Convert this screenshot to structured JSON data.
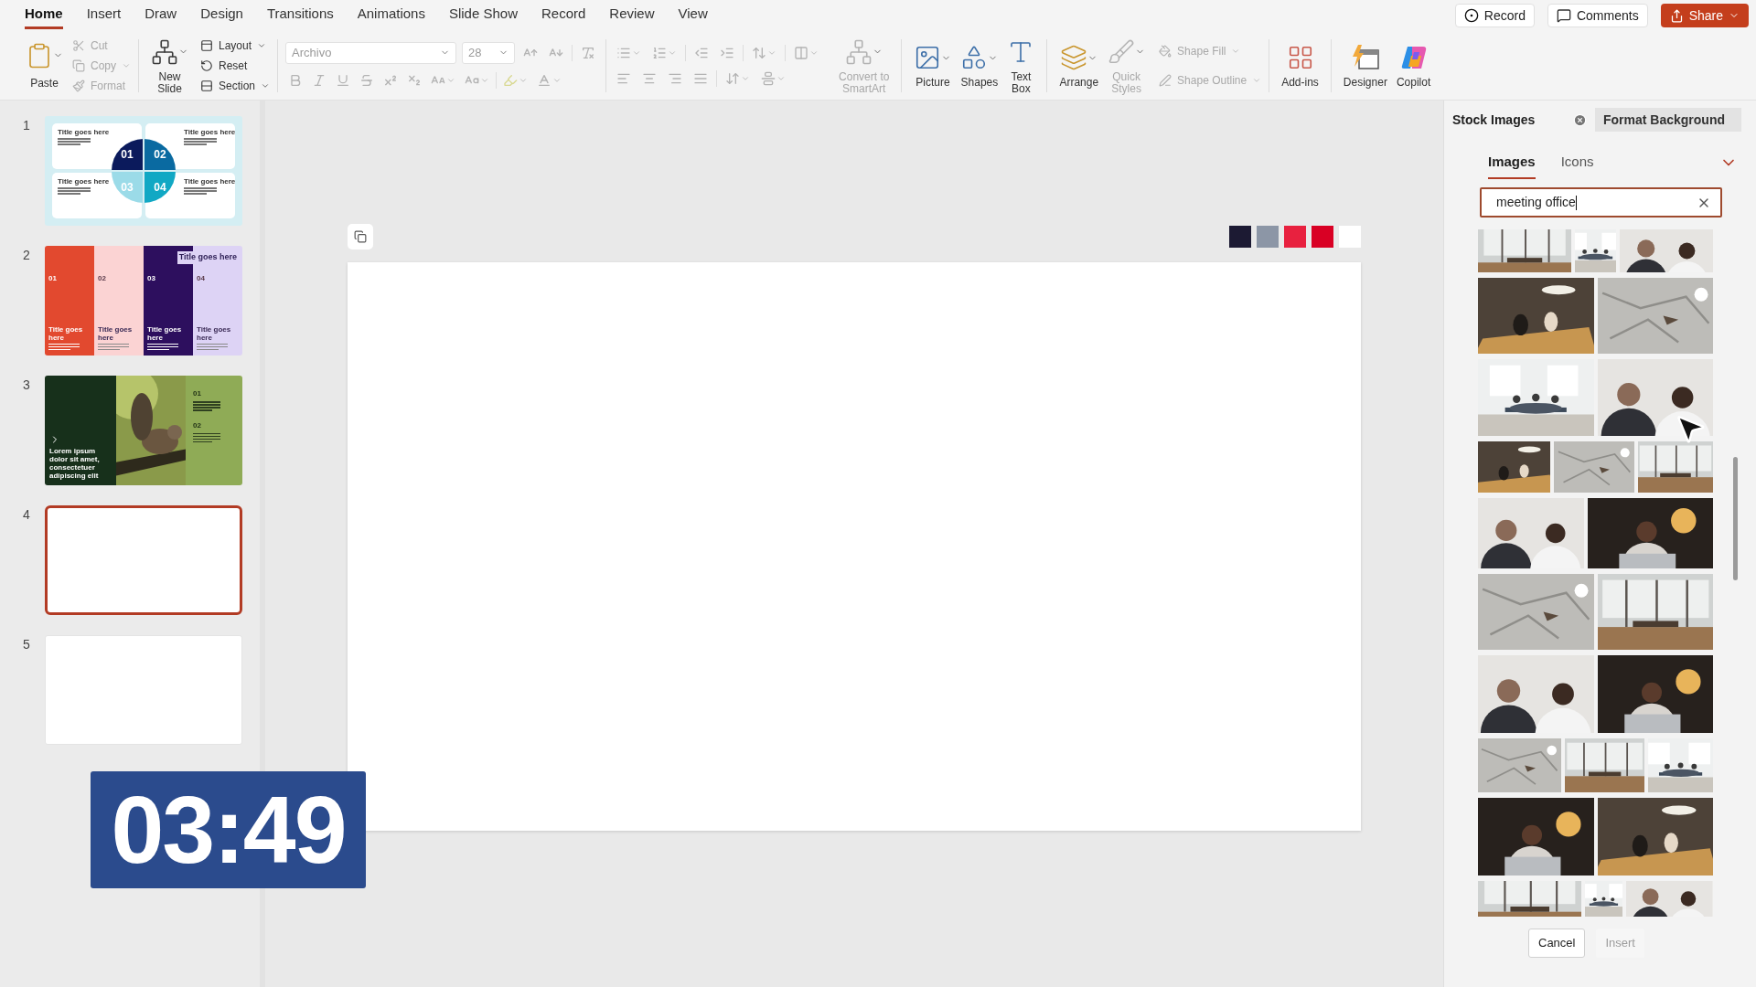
{
  "menu_tabs": [
    {
      "label": "Home",
      "selected": true
    },
    {
      "label": "Insert",
      "selected": false
    },
    {
      "label": "Draw",
      "selected": false
    },
    {
      "label": "Design",
      "selected": false
    },
    {
      "label": "Transitions",
      "selected": false
    },
    {
      "label": "Animations",
      "selected": false
    },
    {
      "label": "Slide Show",
      "selected": false
    },
    {
      "label": "Record",
      "selected": false
    },
    {
      "label": "Review",
      "selected": false
    },
    {
      "label": "View",
      "selected": false
    }
  ],
  "header_buttons": [
    {
      "kind": "record",
      "label": "Record"
    },
    {
      "kind": "comments",
      "label": "Comments"
    },
    {
      "kind": "share",
      "label": "Share"
    }
  ],
  "clipboard": {
    "paste": "Paste",
    "tools": [
      {
        "kind": "cut",
        "label": "Cut",
        "disabled": true
      },
      {
        "kind": "copy",
        "label": "Copy",
        "disabled": true
      },
      {
        "kind": "format",
        "label": "Format",
        "disabled": true
      }
    ]
  },
  "slides_group": {
    "new_slide": "New\nSlide",
    "tools": [
      {
        "kind": "layout",
        "label": "Layout"
      },
      {
        "kind": "reset",
        "label": "Reset"
      },
      {
        "kind": "section",
        "label": "Section"
      }
    ]
  },
  "font": {
    "disabled": true,
    "name": "Archivo",
    "size": "28"
  },
  "insert_buttons": [
    {
      "kind": "smartart",
      "label": "Convert to\nSmartArt",
      "disabled": true
    },
    {
      "kind": "picture",
      "label": "Picture",
      "disabled": false
    },
    {
      "kind": "shapes",
      "label": "Shapes",
      "disabled": false
    },
    {
      "kind": "textbox",
      "label": "Text\nBox",
      "disabled": false
    }
  ],
  "drawing_buttons": [
    {
      "kind": "arrange",
      "label": "Arrange",
      "disabled": false
    },
    {
      "kind": "quickstyles",
      "label": "Quick\nStyles",
      "disabled": true
    }
  ],
  "shape_tools": [
    {
      "kind": "fill",
      "label": "Shape Fill",
      "disabled": true
    },
    {
      "kind": "outline",
      "label": "Shape Outline",
      "disabled": true
    }
  ],
  "addin_buttons": [
    {
      "kind": "addins",
      "label": "Add-ins"
    },
    {
      "kind": "designer",
      "label": "Designer"
    },
    {
      "kind": "copilot",
      "label": "Copilot"
    }
  ],
  "slides": [
    {
      "number": "1",
      "kind": "quadrants",
      "selected": false,
      "titles": [
        "Title goes here",
        "Title goes here",
        "Title goes here",
        "Title goes here"
      ],
      "numbers": [
        "01",
        "02",
        "03",
        "04"
      ]
    },
    {
      "number": "2",
      "kind": "columns",
      "selected": false,
      "heading": "Title goes here",
      "columns": [
        {
          "number": "01",
          "title": "Title goes here",
          "color": "#e2492f"
        },
        {
          "number": "02",
          "title": "Title goes here",
          "color": "#fbd3d3"
        },
        {
          "number": "03",
          "title": "Title goes here",
          "color": "#2d0f5e"
        },
        {
          "number": "04",
          "title": "Title goes here",
          "color": "#ddd3f5"
        }
      ]
    },
    {
      "number": "3",
      "selected": false,
      "caption": "Lorem ipsum dolor sit amet, consectetuer adipiscing elit",
      "numbers": [
        "01",
        "02"
      ]
    },
    {
      "number": "4",
      "kind": "blank",
      "selected": true
    },
    {
      "number": "5",
      "kind": "blank",
      "selected": false
    }
  ],
  "swatches": [
    {
      "color": "#1c1a33"
    },
    {
      "color": "#8c96a6"
    },
    {
      "color": "#e8213f"
    },
    {
      "color": "#d90024"
    },
    {
      "color": "#ffffff"
    }
  ],
  "timer": "03:49",
  "stock_panel": {
    "tabs": [
      {
        "label": "Stock Images",
        "selected": true
      },
      {
        "label": "Format Background",
        "selected": false
      }
    ],
    "subtabs": [
      {
        "label": "Images",
        "selected": true
      },
      {
        "label": "Icons",
        "selected": false
      }
    ],
    "search": "meeting office",
    "buttons": [
      {
        "label": "Cancel",
        "disabled": false
      },
      {
        "label": "Insert",
        "disabled": true
      }
    ]
  }
}
